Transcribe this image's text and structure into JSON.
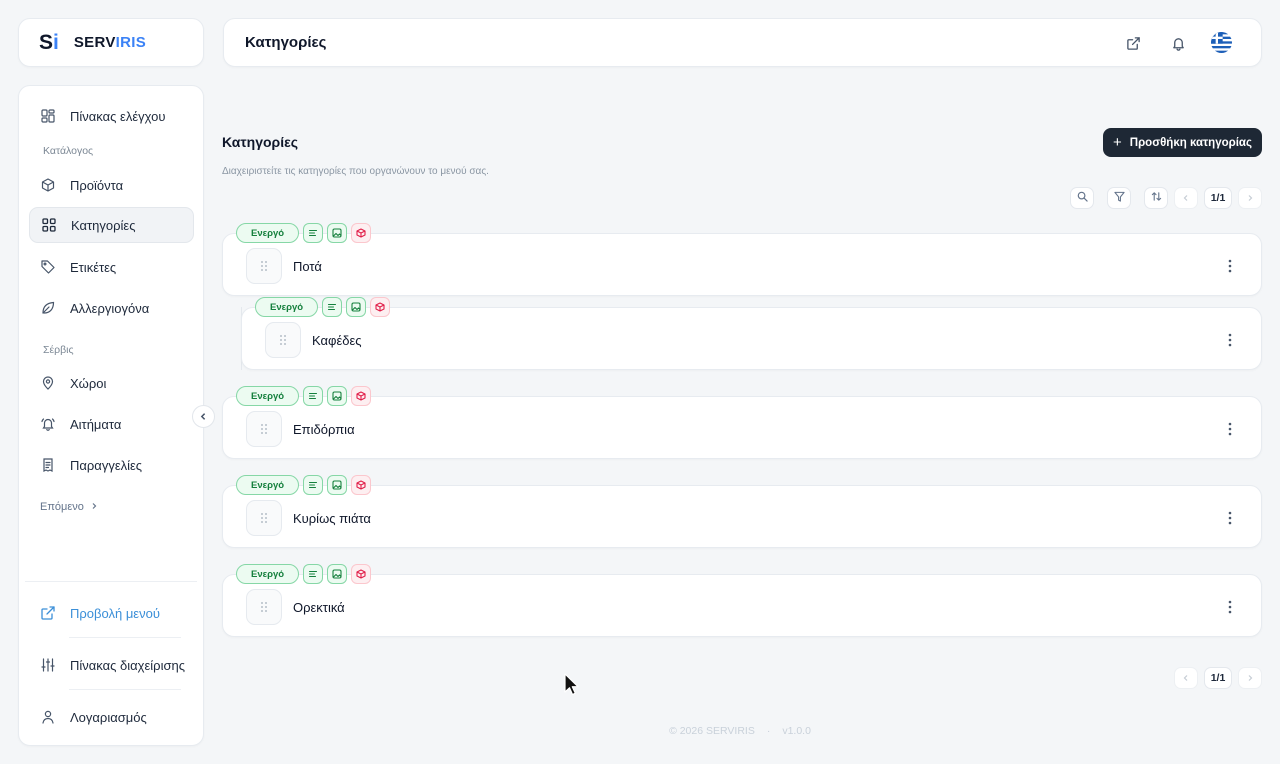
{
  "brand": {
    "mark_s": "S",
    "mark_i": "i",
    "name_a": "SERV",
    "name_b": "IRIS"
  },
  "header": {
    "title": "Κατηγορίες",
    "flag": "greek-flag"
  },
  "sidebar": {
    "dashboard": "Πίνακας ελέγχου",
    "catalog_label": "Κατάλογος",
    "products": "Προϊόντα",
    "categories": "Κατηγορίες",
    "tags": "Ετικέτες",
    "allergens": "Αλλεργιογόνα",
    "service_label": "Σέρβις",
    "spaces": "Χώροι",
    "requests": "Αιτήματα",
    "orders": "Παραγγελίες",
    "next": "Επόμενο",
    "view_menu": "Προβολή μενού",
    "admin_panel": "Πίνακας διαχείρισης",
    "account": "Λογαριασμός"
  },
  "main": {
    "title": "Κατηγορίες",
    "description": "Διαχειριστείτε τις κατηγορίες που οργανώνουν το μενού σας.",
    "add_button": "Προσθήκη κατηγορίας",
    "pagination": "1/1"
  },
  "categories": [
    {
      "name": "Ποτά",
      "status": "Ενεργό",
      "nested": false
    },
    {
      "name": "Καφέδες",
      "status": "Ενεργό",
      "nested": true
    },
    {
      "name": "Επιδόρπια",
      "status": "Ενεργό",
      "nested": false
    },
    {
      "name": "Κυρίως πιάτα",
      "status": "Ενεργό",
      "nested": false
    },
    {
      "name": "Ορεκτικά",
      "status": "Ενεργό",
      "nested": false
    }
  ],
  "footer": {
    "copyright": "© 2026 SERVIRIS",
    "separator": "·",
    "version": "v1.0.0"
  },
  "colors": {
    "accent": "#3b82f6",
    "primary_button": "#1e2835",
    "status_green": "#15803d",
    "badge_red": "#e11d48"
  }
}
